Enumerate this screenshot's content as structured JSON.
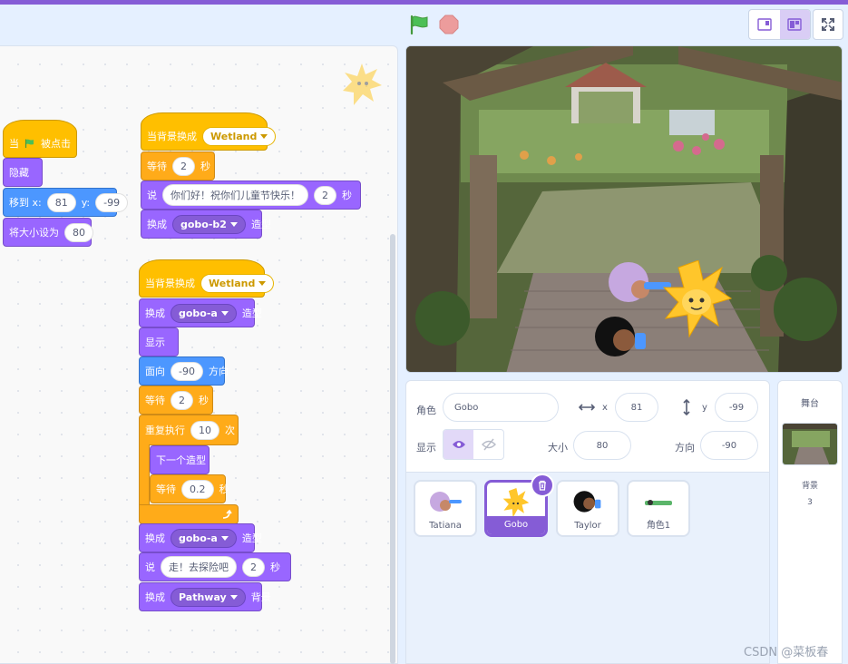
{
  "colors": {
    "accent": "#855cd6",
    "events": "#ffbf00",
    "looks": "#9966ff",
    "motion": "#4c97ff",
    "control": "#ffab19",
    "stop": "#ec9c9c",
    "flag": "#4cbf56"
  },
  "toolbar": {
    "flag_icon": "green-flag-icon",
    "stop_icon": "stop-icon"
  },
  "script1": {
    "hat_when": "当",
    "hat_clicked": "被点击",
    "hide": "隐藏",
    "goto_label": "移到 x:",
    "goto_x": "81",
    "goto_y_label": "y:",
    "goto_y": "-99",
    "size_label": "将大小设为",
    "size_value": "80"
  },
  "script2": {
    "hat_label": "当背景换成",
    "hat_backdrop": "Wetland",
    "wait_label": "等待",
    "wait_value": "2",
    "wait_unit": "秒",
    "say_label": "说",
    "say_text": "你们好！祝你们儿童节快乐！",
    "say_secs": "2",
    "say_unit": "秒",
    "costume_label": "换成",
    "costume_value": "gobo-b2",
    "costume_unit": "造型"
  },
  "script3": {
    "hat_label": "当背景换成",
    "hat_backdrop": "Wetland",
    "costume1_label": "换成",
    "costume1_value": "gobo-a",
    "costume1_unit": "造型",
    "show": "显示",
    "point_label": "面向",
    "point_value": "-90",
    "point_unit": "方向",
    "wait_label": "等待",
    "wait_value": "2",
    "wait_unit": "秒",
    "repeat_label": "重复执行",
    "repeat_value": "10",
    "repeat_unit": "次",
    "next_costume": "下一个造型",
    "inner_wait_label": "等待",
    "inner_wait_value": "0.2",
    "inner_wait_unit": "秒",
    "costume2_label": "换成",
    "costume2_value": "gobo-a",
    "costume2_unit": "造型",
    "say_label": "说",
    "say_text": "走！去探险吧",
    "say_secs": "2",
    "say_unit": "秒",
    "backdrop_label": "换成",
    "backdrop_value": "Pathway",
    "backdrop_unit": "背景"
  },
  "sprite_info": {
    "sprite_label": "角色",
    "sprite_name": "Gobo",
    "x_label": "x",
    "x_value": "81",
    "y_label": "y",
    "y_value": "-99",
    "show_label": "显示",
    "size_label": "大小",
    "size_value": "80",
    "direction_label": "方向",
    "direction_value": "-90"
  },
  "sprites": [
    {
      "name": "Tatiana",
      "icon": "tatiana-icon"
    },
    {
      "name": "Gobo",
      "icon": "gobo-icon"
    },
    {
      "name": "Taylor",
      "icon": "taylor-icon"
    },
    {
      "name": "角色1",
      "icon": "sprite1-icon"
    }
  ],
  "stage_pane": {
    "title": "舞台",
    "backdrop_label": "背景",
    "backdrop_count": "3"
  },
  "watermark": "CSDN @菜板春"
}
